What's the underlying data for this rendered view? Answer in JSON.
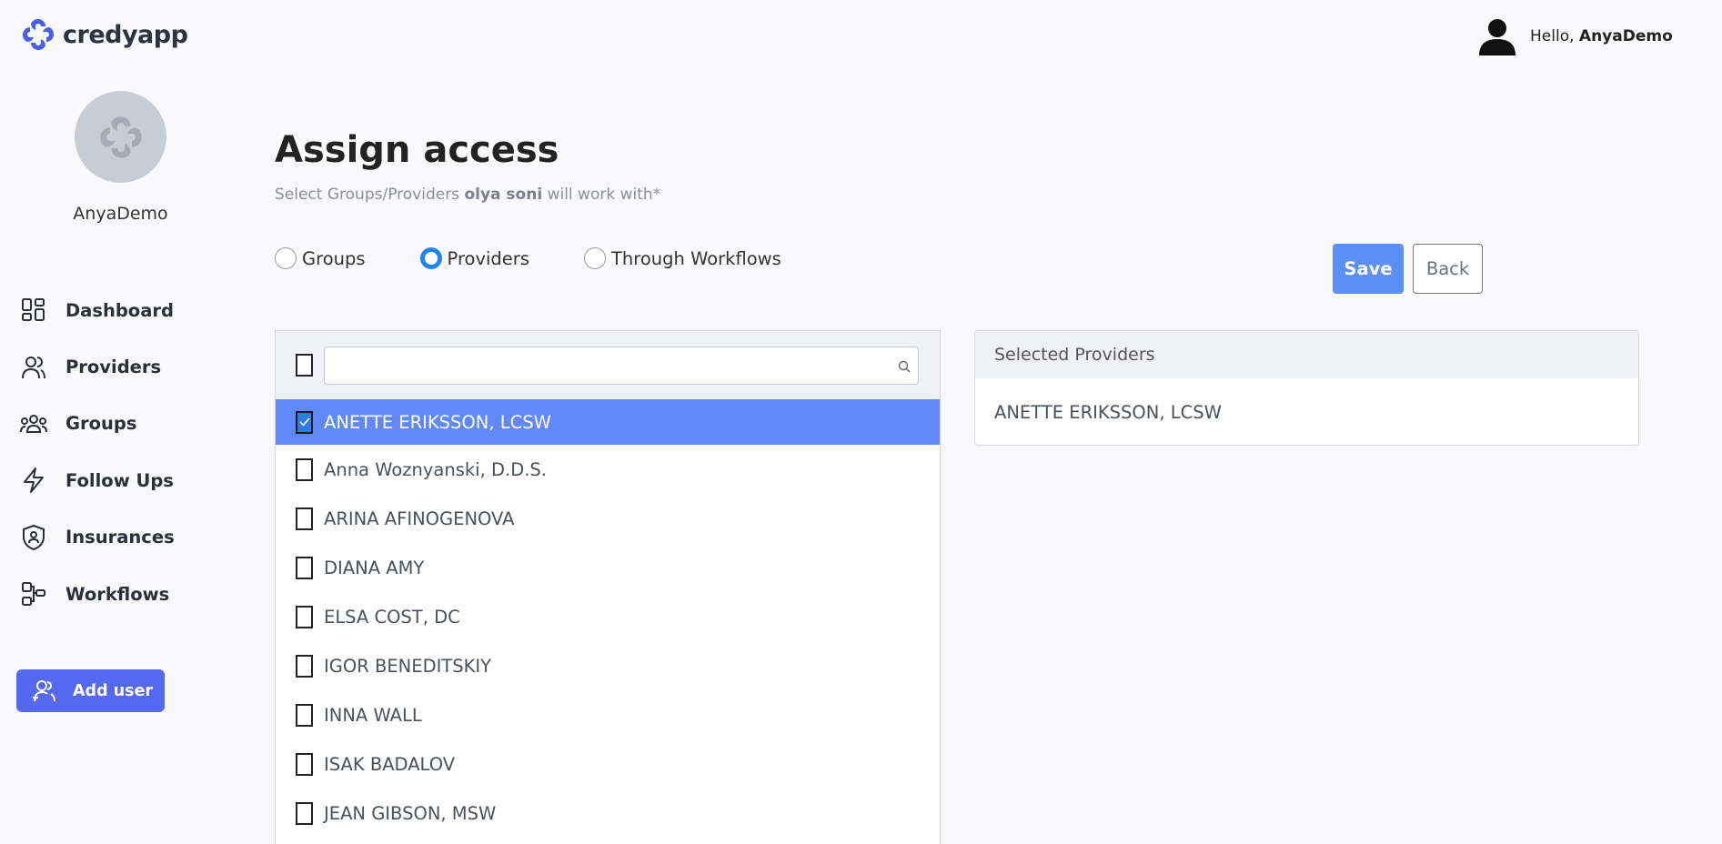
{
  "app": {
    "name": "credyapp"
  },
  "header": {
    "greeting_prefix": "Hello, ",
    "user_name": "AnyaDemo"
  },
  "sidebar": {
    "username": "AnyaDemo",
    "items": [
      {
        "label": "Dashboard",
        "icon": "dashboard-icon"
      },
      {
        "label": "Providers",
        "icon": "providers-icon"
      },
      {
        "label": "Groups",
        "icon": "groups-icon"
      },
      {
        "label": "Follow Ups",
        "icon": "lightning-icon"
      },
      {
        "label": "Insurances",
        "icon": "shield-icon"
      },
      {
        "label": "Workflows",
        "icon": "workflows-icon"
      }
    ],
    "add_user_label": "Add user"
  },
  "main": {
    "title": "Assign access",
    "subtitle_prefix": "Select Groups/Providers ",
    "subtitle_name": "olya soni",
    "subtitle_suffix": " will work with*",
    "radios": [
      {
        "label": "Groups",
        "checked": false
      },
      {
        "label": "Providers",
        "checked": true
      },
      {
        "label": "Through Workflows",
        "checked": false
      }
    ],
    "save_label": "Save",
    "back_label": "Back",
    "search": {
      "value": "",
      "placeholder": ""
    },
    "providers": [
      {
        "name": "ANETTE ERIKSSON, LCSW",
        "checked": true
      },
      {
        "name": "Anna Woznyanski, D.D.S.",
        "checked": false
      },
      {
        "name": "ARINA AFINOGENOVA",
        "checked": false
      },
      {
        "name": "DIANA AMY",
        "checked": false
      },
      {
        "name": "ELSA COST, DC",
        "checked": false
      },
      {
        "name": "IGOR BENEDITSKIY",
        "checked": false
      },
      {
        "name": "INNA WALL",
        "checked": false
      },
      {
        "name": "ISAK BADALOV",
        "checked": false
      },
      {
        "name": "JEAN GIBSON, MSW",
        "checked": false
      }
    ],
    "selected_panel": {
      "title": "Selected Providers",
      "items": [
        "ANETTE ERIKSSON, LCSW"
      ]
    }
  },
  "colors": {
    "accent": "#5468f2",
    "selected_row": "#6088f8",
    "save": "#5d8ff8",
    "radio": "#1e86f0"
  }
}
